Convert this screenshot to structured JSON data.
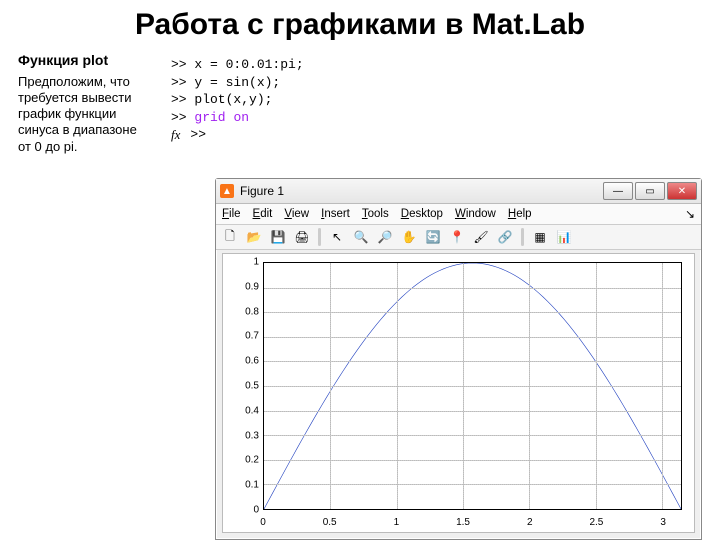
{
  "title": "Работа с графиками в Mat.Lab",
  "left": {
    "func_title": "Функция plot",
    "desc": "Предположим, что требуется вывести график функции синуса в диапазоне от 0 до pi."
  },
  "cmd": {
    "lines": [
      ">> x = 0:0.01:pi;",
      ">> y = sin(x);",
      ">> plot(x,y);",
      ">> grid on",
      ">> "
    ],
    "grid_kw": "grid",
    "on_kw": "on",
    "fx_label": "fx"
  },
  "figure": {
    "window_title": "Figure 1",
    "icon_char": "▲",
    "minimize": "—",
    "maximize": "▭",
    "close": "✕",
    "menu": {
      "file": "File",
      "edit": "Edit",
      "view": "View",
      "insert": "Insert",
      "tools": "Tools",
      "desktop": "Desktop",
      "window": "Window",
      "help": "Help",
      "dock": "↘"
    },
    "toolbar": {
      "new": "🗋",
      "open": "📂",
      "save": "💾",
      "print": "🖨",
      "arrow": "↖",
      "zoomin": "🔍",
      "zoomout": "🔎",
      "pan": "✋",
      "rotate": "🔄",
      "datatip": "📍",
      "brush": "🖌",
      "link": "🔗",
      "colorbar": "▦",
      "legend": "📊"
    }
  },
  "chart_data": {
    "type": "line",
    "title": "",
    "xlabel": "",
    "ylabel": "",
    "xlim": [
      0,
      3.14159
    ],
    "ylim": [
      0,
      1
    ],
    "x_ticks": [
      0,
      0.5,
      1,
      1.5,
      2,
      2.5,
      3
    ],
    "x_tick_labels": [
      "0",
      "0.5",
      "1",
      "1.5",
      "2",
      "2.5",
      "3"
    ],
    "y_ticks": [
      0,
      0.1,
      0.2,
      0.3,
      0.4,
      0.5,
      0.6,
      0.7,
      0.8,
      0.9,
      1
    ],
    "y_tick_labels": [
      "0",
      "0.1",
      "0.2",
      "0.3",
      "0.4",
      "0.5",
      "0.6",
      "0.7",
      "0.8",
      "0.9",
      "1"
    ],
    "grid": true,
    "series": [
      {
        "name": "sin(x)",
        "formula": "y = sin(x)",
        "color": "#1f3fbf"
      }
    ]
  }
}
